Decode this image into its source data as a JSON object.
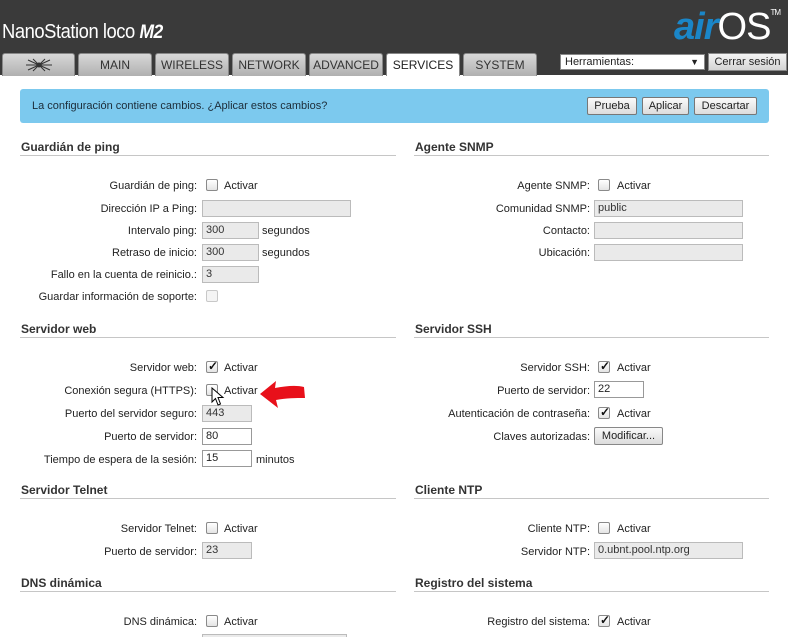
{
  "app": {
    "brand_text": "NanoStation loco",
    "brand_model": "M2",
    "logo_air": "air",
    "logo_os": "OS",
    "logo_tm": "TM"
  },
  "tabs": [
    {
      "label": "MAIN"
    },
    {
      "label": "WIRELESS"
    },
    {
      "label": "NETWORK"
    },
    {
      "label": "ADVANCED"
    },
    {
      "label": "SERVICES"
    },
    {
      "label": "SYSTEM"
    }
  ],
  "toolbar": {
    "tools_value": "Herramientas:",
    "logout_label": "Cerrar sesión"
  },
  "notice": {
    "message": "La configuración contiene cambios. ¿Aplicar estos cambios?",
    "test_label": "Prueba",
    "apply_label": "Aplicar",
    "discard_label": "Descartar"
  },
  "ping_watchdog": {
    "title": "Guardián de ping",
    "enable_label": "Guardián de ping:",
    "ip_label": "Dirección IP a Ping:",
    "ip_value": "",
    "interval_label": "Intervalo ping:",
    "interval_value": "300",
    "delay_label": "Retraso de inicio:",
    "delay_value": "300",
    "fail_label": "Fallo en la cuenta de reinicio.:",
    "fail_value": "3",
    "save_label": "Guardar información de soporte:",
    "unit": "segundos"
  },
  "snmp": {
    "title": "Agente SNMP",
    "enable_label": "Agente SNMP:",
    "community_label": "Comunidad SNMP:",
    "community_value": "public",
    "contact_label": "Contacto:",
    "contact_value": "",
    "location_label": "Ubicación:",
    "location_value": ""
  },
  "web_server": {
    "title": "Servidor web",
    "enable_label": "Servidor web:",
    "https_label": "Conexión segura (HTTPS):",
    "secure_port_label": "Puerto del servidor seguro:",
    "secure_port_value": "443",
    "port_label": "Puerto de servidor:",
    "port_value": "80",
    "timeout_label": "Tiempo de espera de la sesión:",
    "timeout_value": "15",
    "timeout_unit": "minutos"
  },
  "ssh": {
    "title": "Servidor SSH",
    "enable_label": "Servidor SSH:",
    "port_label": "Puerto de servidor:",
    "port_value": "22",
    "password_auth_label": "Autenticación de contraseña:",
    "keys_label": "Claves autorizadas:",
    "modify_label": "Modificar..."
  },
  "telnet": {
    "title": "Servidor Telnet",
    "enable_label": "Servidor Telnet:",
    "port_label": "Puerto de servidor:",
    "port_value": "23"
  },
  "ntp": {
    "title": "Cliente NTP",
    "enable_label": "Cliente NTP:",
    "server_label": "Servidor NTP:",
    "server_value": "0.ubnt.pool.ntp.org"
  },
  "ddns": {
    "title": "DNS dinámica",
    "enable_label": "DNS dinámica:"
  },
  "syslog": {
    "title": "Registro del sistema",
    "enable_label": "Registro del sistema:"
  },
  "common": {
    "enable_text": "Activar"
  },
  "colors": {
    "header_bg": "#3a3a3a",
    "accent": "#1a86c8",
    "notice_bg": "#7cc9ee",
    "annotation_arrow": "#e8101a"
  }
}
